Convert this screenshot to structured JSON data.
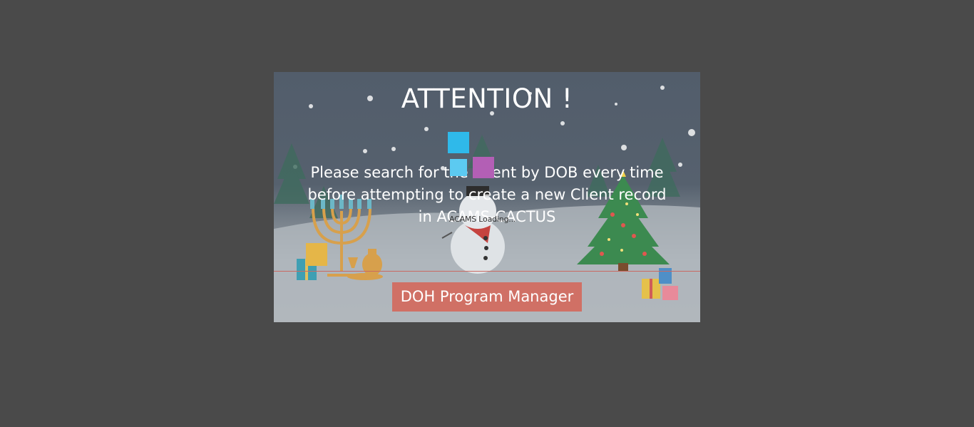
{
  "modal": {
    "title": "ATTENTION !",
    "message": "Please search for the Client by DOB every time before attempting to create a new Client record in ACAMS-CACTUS",
    "button_label": "DOH Program Manager"
  },
  "loader": {
    "text": "ACAMS Loading..."
  },
  "colors": {
    "page_background": "#4a4a4a",
    "button_background": "#d07065",
    "loader_blue": "#2fb9ea",
    "loader_purple": "#b35fb5",
    "loader_light_blue": "#5ccaf1"
  }
}
